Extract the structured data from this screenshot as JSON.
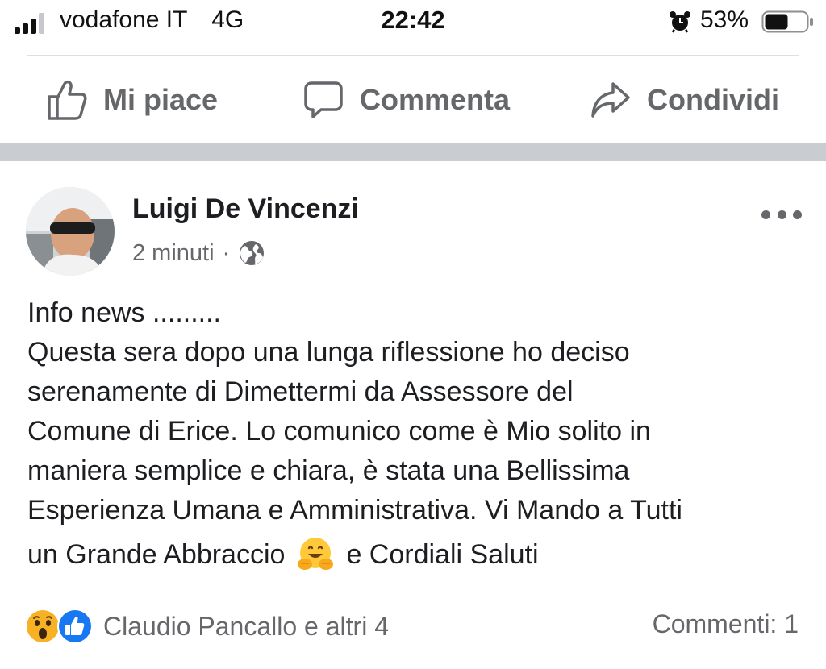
{
  "status_bar": {
    "carrier": "vodafone IT",
    "network": "4G",
    "time": "22:42",
    "battery": "53%",
    "battery_level": 0.53,
    "signal_bars_active": 3,
    "signal_bars_total": 4
  },
  "actions": {
    "like": "Mi piace",
    "comment": "Commenta",
    "share": "Condividi"
  },
  "post": {
    "author": "Luigi De Vincenzi",
    "time_ago": "2 minuti",
    "separator": "·",
    "privacy_icon": "globe-icon",
    "lines": [
      "Info news .........",
      "Questa sera dopo una lunga riflessione ho deciso",
      "serenamente di Dimettermi da Assessore del",
      "Comune di Erice. Lo comunico come è Mio solito in",
      "maniera semplice e chiara, è stata una Bellissima",
      "Esperienza Umana e Amministrativa. Vi Mando a Tutti"
    ],
    "last_line_before_emoji": "un Grande Abbraccio",
    "emoji": "hugging-face-emoji",
    "last_line_after_emoji": "e Cordiali Saluti"
  },
  "reactions": {
    "icons": [
      "wow-reaction-icon",
      "like-reaction-icon"
    ],
    "names": "Claudio Pancallo e altri 4",
    "comments": "Commenti: 1"
  },
  "colors": {
    "text_primary": "#1c1e21",
    "text_secondary": "#65676b",
    "separator_band": "#c9ccd1",
    "like_blue": "#1877f2",
    "wow_yellow": "#f7b125"
  }
}
